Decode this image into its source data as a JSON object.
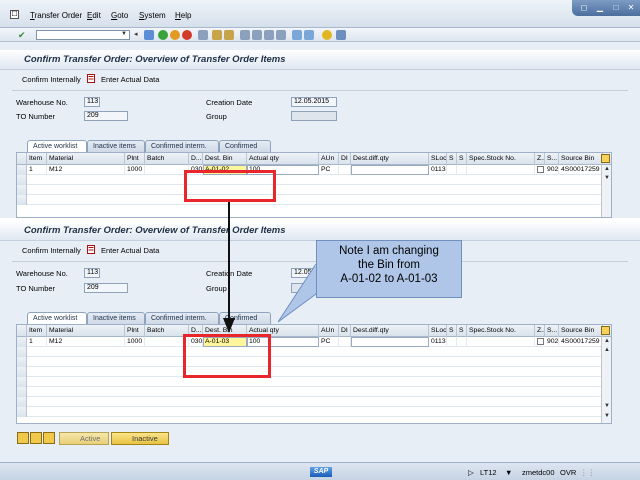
{
  "menubar": {
    "items": [
      "Transfer Order",
      "Edit",
      "Goto",
      "System",
      "Help"
    ]
  },
  "screen": {
    "title": "Confirm Transfer Order: Overview of Transfer Order Items",
    "toolbar": {
      "confirm_internally": "Confirm Internally",
      "enter_actual_data": "Enter Actual Data"
    },
    "labels": {
      "warehouse_no": "Warehouse No.",
      "to_number": "TO Number",
      "creation_date": "Creation Date",
      "group": "Group"
    },
    "values_top": {
      "warehouse_no": "113",
      "to_number": "209",
      "creation_date": "12.05.2015"
    },
    "values_bottom": {
      "warehouse_no": "113",
      "to_number": "209",
      "creation_date": "12.05"
    },
    "tabs": [
      "Active worklist",
      "Inactive items",
      "Confirmed interm.",
      "Confirmed"
    ],
    "table_headers": [
      "Item",
      "Material",
      "Plnt",
      "Batch",
      "D...",
      "Dest. Bin",
      "Actual qty",
      "AUn",
      "DI",
      "Dest.diff.qty",
      "SLoc",
      "S",
      "S",
      "Spec.Stock No.",
      "Z...",
      "S...",
      "Source Bin"
    ],
    "row_top": {
      "item": "1",
      "material": "M12",
      "plant": "1000",
      "dest_type": "030",
      "dest_bin": "A-01-02",
      "actual_qty": "100",
      "aun": "PC",
      "sloc": "0113",
      "s_code": "902",
      "source_bin": "4S00017259"
    },
    "row_bottom": {
      "item": "1",
      "material": "M12",
      "plant": "1000",
      "dest_type": "030",
      "dest_bin": "A-01-03",
      "actual_qty": "100",
      "aun": "PC",
      "sloc": "0113",
      "s_code": "902",
      "source_bin": "4S00017259"
    },
    "bottom_buttons": {
      "active": "Active",
      "inactive": "Inactive"
    }
  },
  "note": {
    "line1": "Note I am changing",
    "line2": "the Bin from",
    "line3": "A-01-02 to A-01-03"
  },
  "status": {
    "system": "LT12",
    "server": "zmetdc00",
    "mode": "OVR",
    "logo": "SAP"
  },
  "colors": {
    "highlight": "#e8262b",
    "note_bg": "#afc6e8",
    "input_highlight": "#fff59a"
  }
}
